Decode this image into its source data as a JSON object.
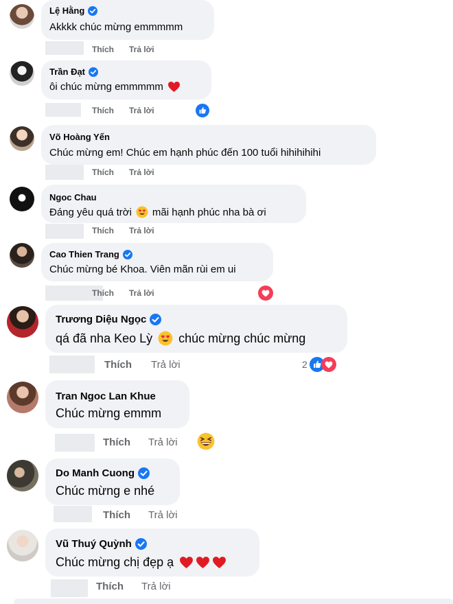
{
  "actions": {
    "like": "Thích",
    "reply": "Trả lời"
  },
  "comments": [
    {
      "name": "Lệ Hằng",
      "text": "Akkkk chúc mừng emmmmm"
    },
    {
      "name": "Trần Đạt",
      "text": "ôi chúc mừng emmmmm"
    },
    {
      "name": "Võ Hoàng Yến",
      "text": "Chúc mừng em! Chúc em hạnh phúc đến 100 tuổi hihihihihi"
    },
    {
      "name": "Ngoc Chau",
      "text_before": "Đáng yêu quá trời",
      "text_after": "mãi hạnh phúc nha bà ơi"
    },
    {
      "name": "Cao Thien Trang",
      "text": "Chúc mừng bé Khoa. Viên mãn rùi em ui"
    },
    {
      "name": "Trương Diệu Ngọc",
      "text_before": "qá đã nha Keo Lỳ",
      "text_after": "chúc mừng chúc mừng",
      "reaction_count": "2"
    },
    {
      "name": "Tran Ngoc Lan Khue",
      "text": "Chúc mừng emmm"
    },
    {
      "name": "Do Manh Cuong",
      "text": "Chúc mừng e nhé"
    },
    {
      "name": "Vũ Thuý Quỳnh",
      "text": "Chúc mừng chị đẹp ạ"
    }
  ],
  "colors": {
    "bubble": "#f0f2f5",
    "muted": "#65676b",
    "verified": "#1877f2",
    "love": "#f33e58"
  },
  "icons": [
    "verified-badge-icon",
    "heart-emoji-icon",
    "heart-eyes-emoji-icon",
    "grinning-squint-emoji-icon",
    "like-reaction-icon",
    "love-reaction-icon"
  ]
}
